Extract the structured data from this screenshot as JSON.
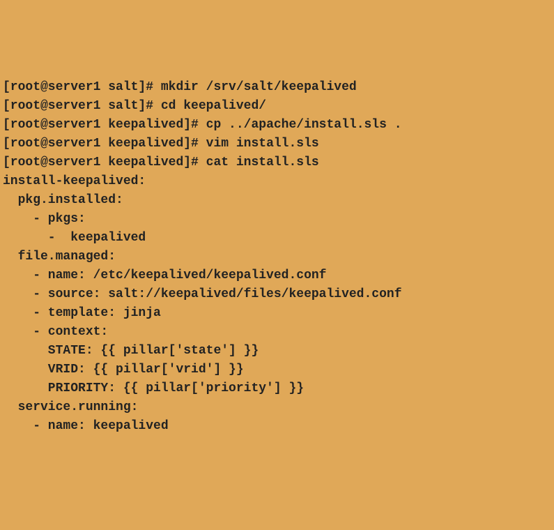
{
  "lines": [
    {
      "prompt": "[root@server1 salt]# ",
      "command": "mkdir /srv/salt/keepalived"
    },
    {
      "prompt": "[root@server1 salt]# ",
      "command": "cd keepalived/"
    },
    {
      "prompt": "[root@server1 keepalived]# ",
      "command": "cp ../apache/install.sls ."
    },
    {
      "prompt": "[root@server1 keepalived]# ",
      "command": "vim install.sls"
    },
    {
      "prompt": "[root@server1 keepalived]# ",
      "command": "cat install.sls"
    }
  ],
  "output_lines": [
    "install-keepalived:",
    "  pkg.installed:",
    "    - pkgs:",
    "      -  keepalived",
    "",
    "  file.managed:",
    "    - name: /etc/keepalived/keepalived.conf",
    "    - source: salt://keepalived/files/keepalived.conf",
    "    - template: jinja",
    "    - context:",
    "      STATE: {{ pillar['state'] }}",
    "      VRID: {{ pillar['vrid'] }}",
    "      PRIORITY: {{ pillar['priority'] }}",
    "",
    "  service.running:",
    "    - name: keepalived"
  ]
}
